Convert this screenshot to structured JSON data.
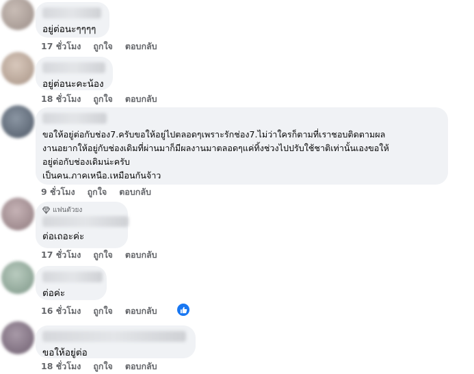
{
  "comments": [
    {
      "text": "อยู่ต่อนะๆๆๆๆ",
      "time": "17 ชั่วโมง",
      "like": "ถูกใจ",
      "reply": "ตอบกลับ"
    },
    {
      "text": "อยู่ต่อนะคะน้อง",
      "time": "18 ชั่วโมง",
      "like": "ถูกใจ",
      "reply": "ตอบกลับ"
    },
    {
      "text": "ขอให้อยู่ต่อกับช่อง7.ครับขอให้อยู่ไปตลอดๆเพราะรักช่อง7.ไม่ว่าใครก็ตามที่เราชอบติดตามผล\nงานอยากให้อยู่กับช่องเดิมที่ผ่านมาก็มีผลงานมาตลอดๆแค่ทิ้งช่วงไปปรับใช้ชาติเท่านั้นเองขอให้\nอยู่ต่อกับช่องเดิมน่ะครับ\nเป็นคน.ภาคเหนือ.เหมือนกันจ้าว",
      "time": "9 ชั่วโมง",
      "like": "ถูกใจ",
      "reply": "ตอบกลับ"
    },
    {
      "badge": "แฟนตัวยง",
      "text": "ต่อเถอะค่ะ",
      "time": "17 ชั่วโมง",
      "like": "ถูกใจ",
      "reply": "ตอบกลับ"
    },
    {
      "text": "ต่อค่ะ",
      "time": "16 ชั่วโมง",
      "like": "ถูกใจ",
      "reply": "ตอบกลับ",
      "reaction": "like-icon"
    },
    {
      "text": "ขอให้อยู่ต่อ",
      "time": "18 ชั่วโมง",
      "like": "ถูกใจ",
      "reply": "ตอบกลับ"
    }
  ],
  "colors": {
    "bubble": "#f0f2f5",
    "meta": "#65676b",
    "like_blue": "#1877f2"
  }
}
